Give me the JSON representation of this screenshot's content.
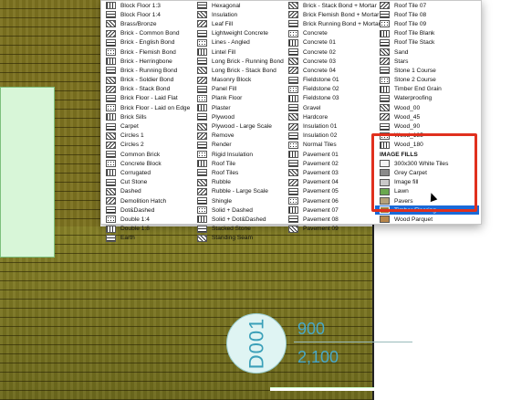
{
  "canvas": {
    "door_tag": "D001",
    "door_width": "900",
    "door_height": "2,100"
  },
  "menu": {
    "columns": [
      {
        "items": [
          "Block Floor 1:3",
          "Block Floor 1:4",
          "Brass/Bronze",
          "Brick - Common Bond",
          "Brick - English Bond",
          "Brick - Flemish Bond",
          "Brick - Herringbone",
          "Brick - Running Bond",
          "Brick - Soldier Bond",
          "Brick - Stack Bond",
          "Brick Floor - Laid Flat",
          "Brick Floor - Laid on Edge",
          "Brick Sills",
          "Carpet",
          "Circles 1",
          "Circles 2",
          "Common Brick",
          "Concrete Block",
          "Corrugated",
          "Cut Stone",
          "Dashed",
          "Demolition Hatch",
          "Dot&Dashed",
          "Double 1:4",
          "Double 1:8",
          "Earth"
        ]
      },
      {
        "items": [
          "Hexagonal",
          "Insulation",
          "Leaf Fill",
          "Lightweight Concrete",
          "Lines - Angled",
          "Lintel Fill",
          "Long Brick - Running Bond",
          "Long Brick - Stack Bond",
          "Masonry Block",
          "Panel Fill",
          "Plank Floor",
          "Plaster",
          "Plywood",
          "Plywood - Large Scale",
          "Remove",
          "Render",
          "Rigid Insulation",
          "Roof Tile",
          "Roof Tiles",
          "Rubble",
          "Rubble - Large Scale",
          "Shingle",
          "Solid + Dashed",
          "Solid + Dot&Dashed",
          "Stacked Stone",
          "Standing Seam"
        ]
      },
      {
        "items": [
          "Brick - Stack Bond + Mortar",
          "Brick Flemish Bond + Mortar",
          "Brick Running Bond + Mortar",
          "Concrete",
          "Concrete 01",
          "Concrete 02",
          "Concrete 03",
          "Concrete 04",
          "Fieldstone 01",
          "Fieldstone 02",
          "Fieldstone 03",
          "Gravel",
          "Hardcore",
          "Insulation 01",
          "Insulation 02",
          "Normal Tiles",
          "Pavement 01",
          "Pavement 02",
          "Pavement 03",
          "Pavement 04",
          "Pavement 05",
          "Pavement 06",
          "Pavement 07",
          "Pavement 08",
          "Pavement 09"
        ]
      },
      {
        "items": [
          "Roof Tile 07",
          "Roof Tile 08",
          "Roof Tile 09",
          "Roof Tile Blank",
          "Roof Tile Stack",
          "Sand",
          "Stars",
          "Stone 1 Course",
          "Stone 2 Course",
          "Timber End Grain",
          "Waterproofing",
          "Wood_00",
          "Wood_45",
          "Wood_90",
          "Wood_135",
          "Wood_180"
        ],
        "image_fills_header": "IMAGE FILLS",
        "image_fills": [
          "300x300 White Tiles",
          "Grey Carpet",
          "Image fill",
          "Lawn",
          "Pavers",
          "Timber Flooring",
          "Wood Parquet"
        ],
        "selected": "Timber Flooring"
      }
    ]
  },
  "colors": {
    "selection": "#1a6ad8",
    "highlight_border": "#e0301e",
    "floor": "#7d7320",
    "dimension_text": "#48a8c8"
  }
}
